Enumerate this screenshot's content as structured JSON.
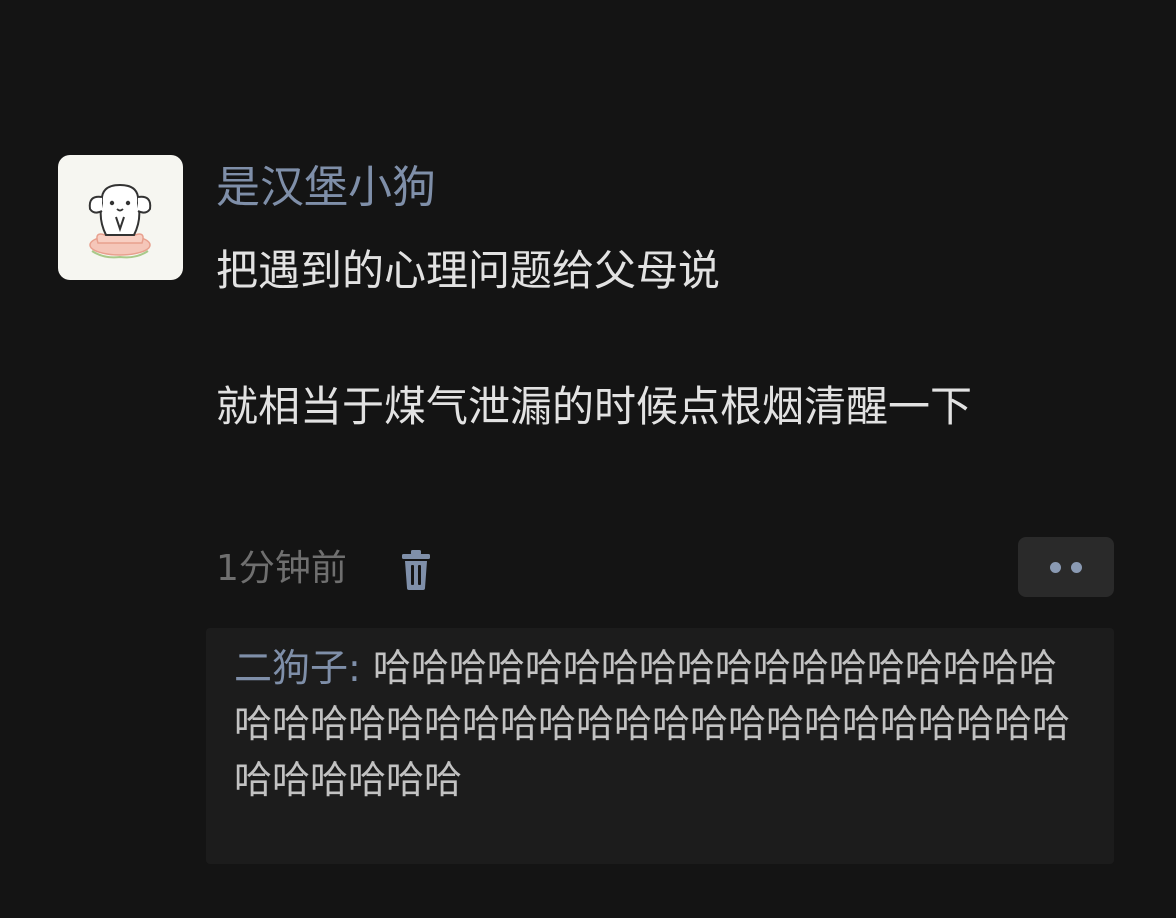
{
  "post": {
    "author": "是汉堡小狗",
    "paragraphs": [
      "把遇到的心理问题给父母说",
      "就相当于煤气泄漏的时候点根烟清醒一下"
    ],
    "timestamp": "1分钟前",
    "delete_icon": "trash-icon",
    "more_icon": "more-dots-icon"
  },
  "comments": [
    {
      "name": "二狗子",
      "separator": ": ",
      "text": "哈哈哈哈哈哈哈哈哈哈哈哈哈哈哈哈哈哈哈哈哈哈哈哈哈哈哈哈哈哈哈哈哈哈哈哈哈哈哈哈哈哈哈哈哈哈"
    }
  ],
  "colors": {
    "background": "#141414",
    "name": "#7f8fa9",
    "text": "#e2e2e2",
    "muted": "#6f6f6f",
    "comment_bg": "#1c1c1c"
  }
}
